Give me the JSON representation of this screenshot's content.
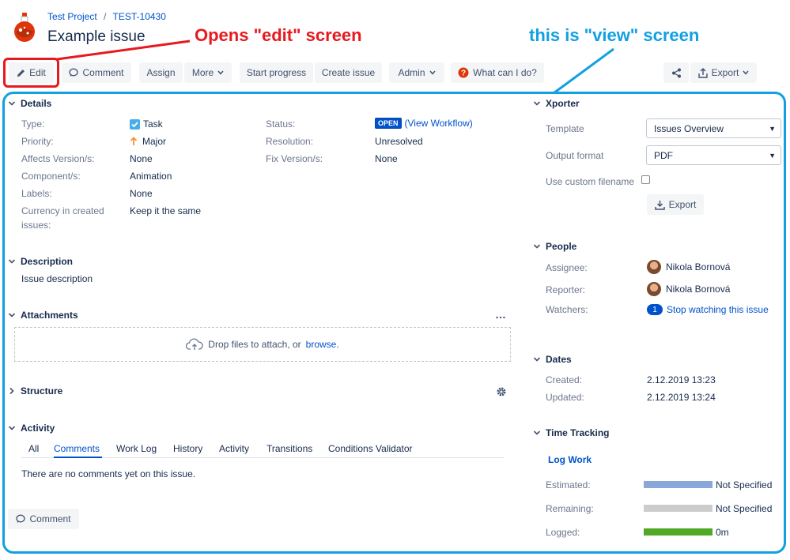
{
  "header": {
    "project": "Test Project",
    "separator": "/",
    "issue_key": "TEST-10430",
    "title": "Example issue"
  },
  "annotations": {
    "edit": "Opens \"edit\" screen",
    "view": "this is \"view\" screen"
  },
  "toolbar": {
    "edit": "Edit",
    "comment": "Comment",
    "assign": "Assign",
    "more": "More",
    "start_progress": "Start progress",
    "create_issue": "Create issue",
    "admin": "Admin",
    "what_can_i_do": "What can I do?",
    "export": "Export"
  },
  "details": {
    "heading": "Details",
    "type_label": "Type:",
    "type_value": "Task",
    "priority_label": "Priority:",
    "priority_value": "Major",
    "affects_label": "Affects Version/s:",
    "affects_value": "None",
    "component_label": "Component/s:",
    "component_value": "Animation",
    "labels_label": "Labels:",
    "labels_value": "None",
    "currency_label_1": "Currency in created",
    "currency_label_2": "issues:",
    "currency_value": "Keep it the same",
    "status_label": "Status:",
    "status_value": "OPEN",
    "view_workflow": "(View Workflow)",
    "resolution_label": "Resolution:",
    "resolution_value": "Unresolved",
    "fix_label": "Fix Version/s:",
    "fix_value": "None"
  },
  "description": {
    "heading": "Description",
    "text": "Issue description"
  },
  "attachments": {
    "heading": "Attachments",
    "more": "…",
    "drop_text": "Drop files to attach, or",
    "browse": "browse."
  },
  "structure": {
    "heading": "Structure"
  },
  "activity": {
    "heading": "Activity",
    "tabs": [
      "All",
      "Comments",
      "Work Log",
      "History",
      "Activity",
      "Transitions",
      "Conditions Validator"
    ],
    "active_tab": "Comments",
    "empty": "There are no comments yet on this issue.",
    "comment_button": "Comment"
  },
  "xporter": {
    "heading": "Xporter",
    "template_label": "Template",
    "template_value": "Issues Overview",
    "format_label": "Output format",
    "format_value": "PDF",
    "custom_filename_label": "Use custom filename",
    "custom_filename_checked": false,
    "export_button": "Export"
  },
  "people": {
    "heading": "People",
    "assignee_label": "Assignee:",
    "assignee": "Nikola Bornová",
    "reporter_label": "Reporter:",
    "reporter": "Nikola Bornová",
    "watchers_label": "Watchers:",
    "watchers_count": "1",
    "watch_link": "Stop watching this issue"
  },
  "dates": {
    "heading": "Dates",
    "created_label": "Created:",
    "created": "2.12.2019 13:23",
    "updated_label": "Updated:",
    "updated": "2.12.2019 13:24"
  },
  "time_tracking": {
    "heading": "Time Tracking",
    "log_work": "Log Work",
    "estimated_label": "Estimated:",
    "estimated": "Not Specified",
    "remaining_label": "Remaining:",
    "remaining": "Not Specified",
    "logged_label": "Logged:",
    "logged": "0m",
    "colors": {
      "estimated": "#89a8d8",
      "remaining": "#cccccc",
      "logged": "#51a825"
    }
  },
  "colors": {
    "annotation_red": "#e8191e",
    "annotation_blue": "#11a0e2",
    "link": "#0052cc"
  }
}
